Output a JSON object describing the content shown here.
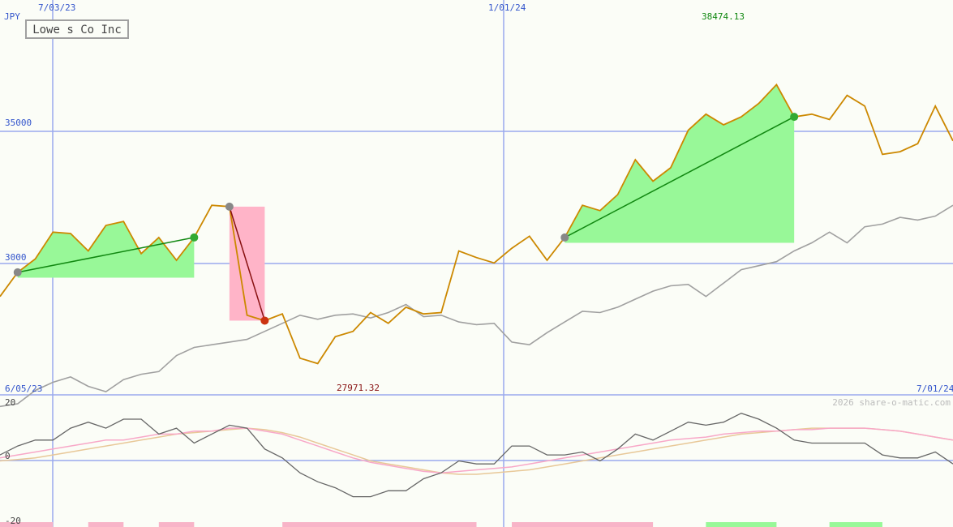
{
  "chart_data": {
    "type": "line",
    "title": "Lowe s Co Inc",
    "currency": "JPY",
    "dates_top": [
      "7/03/23",
      "1/01/24"
    ],
    "dates_bottom": [
      "6/05/23",
      "7/01/24"
    ],
    "price_ticks": [
      "35000",
      "3000"
    ],
    "high_label": "38474.13",
    "low_label": "27971.32",
    "watermark": "2026 share-o-matic.com",
    "oscillator_ticks": [
      "20",
      "0",
      "-20"
    ],
    "price_range": [
      26500,
      39500
    ],
    "price": [
      29200,
      30100,
      30600,
      31600,
      31550,
      30900,
      31850,
      32000,
      30800,
      31400,
      30550,
      31400,
      32600,
      32550,
      28500,
      28300,
      28550,
      26900,
      26700,
      27700,
      27900,
      28600,
      28200,
      28800,
      28550,
      28600,
      30900,
      30650,
      30450,
      31000,
      31450,
      30550,
      31400,
      32600,
      32400,
      33000,
      34300,
      33500,
      34000,
      35400,
      36000,
      35600,
      35900,
      36400,
      37100,
      35900,
      36000,
      35800,
      36700,
      36300,
      34500,
      34600,
      34900,
      36300,
      35000
    ],
    "moving_average": [
      25100,
      25200,
      25700,
      26000,
      26200,
      25850,
      25650,
      26100,
      26300,
      26400,
      27000,
      27300,
      27400,
      27500,
      27600,
      27900,
      28200,
      28500,
      28350,
      28500,
      28550,
      28400,
      28600,
      28900,
      28450,
      28500,
      28250,
      28150,
      28200,
      27500,
      27400,
      27850,
      28250,
      28650,
      28600,
      28800,
      29100,
      29400,
      29600,
      29650,
      29200,
      29700,
      30200,
      30350,
      30500,
      30900,
      31200,
      31600,
      31200,
      31800,
      31900,
      32150,
      32050,
      32200,
      32600
    ],
    "oscillator_1": [
      2,
      5,
      7,
      7,
      11,
      13,
      11,
      14,
      14,
      9,
      11,
      6,
      9,
      12,
      11,
      4,
      1,
      -4,
      -7,
      -9,
      -12,
      -12,
      -10,
      -10,
      -6,
      -4,
      0,
      -1,
      -1,
      5,
      5,
      2,
      2,
      3,
      0,
      4,
      9,
      7,
      10,
      13,
      12,
      13,
      16,
      14,
      11,
      7,
      6,
      6,
      6,
      6,
      2,
      1,
      1,
      3,
      -1
    ],
    "oscillator_2": [
      1,
      2,
      3,
      4,
      5,
      6,
      7,
      7,
      8,
      9,
      9,
      10,
      10,
      11,
      11,
      10,
      9,
      7,
      5,
      3,
      1,
      -0.5,
      -1.5,
      -2.5,
      -3.5,
      -4,
      -3.5,
      -3,
      -2.5,
      -2,
      -1,
      0,
      1,
      2,
      3,
      4,
      5,
      6,
      7,
      7.5,
      8,
      9,
      9.5,
      10,
      10,
      10.5,
      10.5,
      11,
      11,
      11,
      10.5,
      10,
      9,
      8,
      7
    ],
    "oscillator_3": [
      0,
      0.5,
      1,
      2,
      3,
      4,
      5,
      6,
      7,
      8,
      9,
      9.5,
      10,
      10.5,
      11,
      10.5,
      9.5,
      8,
      6,
      4,
      2,
      0,
      -1,
      -2,
      -3,
      -4,
      -4.5,
      -4.5,
      -4,
      -3.5,
      -3,
      -2,
      -1,
      0,
      1,
      2,
      3,
      4,
      5,
      6,
      7,
      8,
      9,
      9.5,
      10,
      10.5,
      11,
      11,
      11,
      11,
      10.5,
      10,
      9,
      8,
      7
    ],
    "trades": [
      {
        "from": 1,
        "to": 11,
        "type": "gain"
      },
      {
        "from": 13,
        "to": 15,
        "type": "loss"
      },
      {
        "from": 32,
        "to": 45,
        "type": "gain"
      }
    ],
    "volume_blocks": [
      {
        "from": 0,
        "to": 3,
        "color": "#f8b4c8"
      },
      {
        "from": 5,
        "to": 7,
        "color": "#f8b4c8"
      },
      {
        "from": 9,
        "to": 11,
        "color": "#f8b4c8"
      },
      {
        "from": 16,
        "to": 27,
        "color": "#f8b4c8"
      },
      {
        "from": 29,
        "to": 37,
        "color": "#f8b4c8"
      },
      {
        "from": 40,
        "to": 44,
        "color": "#98f898"
      },
      {
        "from": 47,
        "to": 50,
        "color": "#98f898"
      }
    ],
    "colors": {
      "price": "#cc8800",
      "average": "#a0a0a0",
      "gain_fill": "#98f898",
      "loss_fill": "#ffb4c8",
      "grid": "#99aaee",
      "text_blue": "#3355cc",
      "osc_dark": "#666666",
      "osc_pink": "#f8a8c8",
      "osc_tan": "#e8c898",
      "high": "#118811",
      "low": "#881111"
    }
  }
}
